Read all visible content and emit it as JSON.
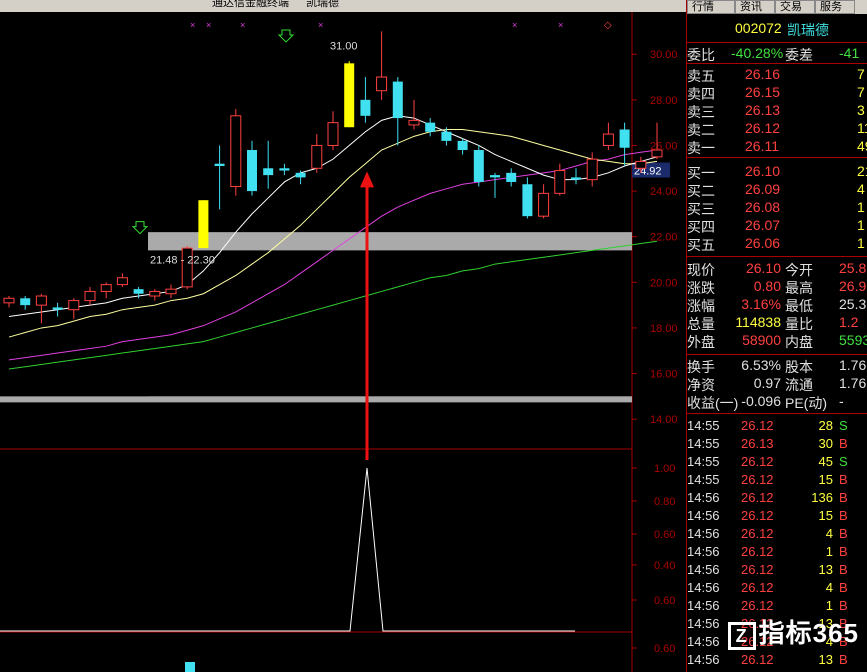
{
  "title": {
    "app": "通达信金融终端",
    "stock_name": "凯瑞德"
  },
  "tabs": [
    "行情",
    "资讯",
    "交易",
    "服务"
  ],
  "chart_data": {
    "type": "candlestick",
    "price_ticks": [
      "30.00",
      "28.00",
      "26.00",
      "24.00",
      "22.00",
      "20.00",
      "18.00",
      "16.00",
      "14.00"
    ],
    "price_range": [
      13.0,
      31.5
    ],
    "current_price_label": "24.92",
    "annotations": [
      "31.00",
      "21.48 - 22.30"
    ],
    "candles": [
      {
        "o": 19.1,
        "c": 19.3,
        "h": 19.4,
        "l": 18.9
      },
      {
        "o": 19.3,
        "c": 19.0,
        "h": 19.4,
        "l": 18.8
      },
      {
        "o": 19.0,
        "c": 19.4,
        "h": 19.5,
        "l": 18.2
      },
      {
        "o": 18.9,
        "c": 18.8,
        "h": 19.1,
        "l": 18.5
      },
      {
        "o": 18.8,
        "c": 19.2,
        "h": 19.3,
        "l": 18.4
      },
      {
        "o": 19.2,
        "c": 19.6,
        "h": 19.8,
        "l": 19.0
      },
      {
        "o": 19.6,
        "c": 19.9,
        "h": 20.0,
        "l": 19.3
      },
      {
        "o": 19.9,
        "c": 20.2,
        "h": 20.4,
        "l": 19.8
      },
      {
        "o": 19.7,
        "c": 19.5,
        "h": 19.8,
        "l": 19.3
      },
      {
        "o": 19.4,
        "c": 19.6,
        "h": 19.7,
        "l": 19.2
      },
      {
        "o": 19.5,
        "c": 19.7,
        "h": 19.9,
        "l": 19.3
      },
      {
        "o": 19.8,
        "c": 21.5,
        "h": 21.6,
        "l": 19.7
      },
      {
        "o": 21.5,
        "c": 23.6,
        "h": 23.6,
        "l": 21.5
      },
      {
        "o": 25.2,
        "c": 25.1,
        "h": 26.0,
        "l": 23.2
      },
      {
        "o": 24.2,
        "c": 27.3,
        "h": 27.6,
        "l": 23.8
      },
      {
        "o": 25.8,
        "c": 24.0,
        "h": 26.2,
        "l": 23.8
      },
      {
        "o": 25.0,
        "c": 24.7,
        "h": 26.2,
        "l": 24.1
      },
      {
        "o": 25.0,
        "c": 24.9,
        "h": 25.2,
        "l": 24.7
      },
      {
        "o": 24.8,
        "c": 24.6,
        "h": 24.9,
        "l": 24.3
      },
      {
        "o": 25.0,
        "c": 26.0,
        "h": 26.5,
        "l": 24.8
      },
      {
        "o": 26.0,
        "c": 27.0,
        "h": 27.5,
        "l": 25.8
      },
      {
        "o": 26.8,
        "c": 29.6,
        "h": 29.7,
        "l": 26.8
      },
      {
        "o": 28.0,
        "c": 27.3,
        "h": 29.0,
        "l": 27.0
      },
      {
        "o": 28.4,
        "c": 29.0,
        "h": 31.0,
        "l": 28.0
      },
      {
        "o": 28.8,
        "c": 27.2,
        "h": 29.0,
        "l": 26.0
      },
      {
        "o": 26.9,
        "c": 27.1,
        "h": 28.0,
        "l": 26.7
      },
      {
        "o": 27.0,
        "c": 26.6,
        "h": 27.2,
        "l": 26.4
      },
      {
        "o": 26.6,
        "c": 26.2,
        "h": 26.8,
        "l": 26.0
      },
      {
        "o": 26.2,
        "c": 25.8,
        "h": 26.3,
        "l": 25.6
      },
      {
        "o": 25.8,
        "c": 24.4,
        "h": 26.0,
        "l": 24.2
      },
      {
        "o": 24.7,
        "c": 24.6,
        "h": 24.8,
        "l": 23.7
      },
      {
        "o": 24.8,
        "c": 24.4,
        "h": 25.0,
        "l": 24.2
      },
      {
        "o": 24.3,
        "c": 22.9,
        "h": 24.6,
        "l": 22.8
      },
      {
        "o": 22.9,
        "c": 23.9,
        "h": 24.3,
        "l": 22.8
      },
      {
        "o": 23.9,
        "c": 24.9,
        "h": 25.2,
        "l": 23.8
      },
      {
        "o": 24.6,
        "c": 24.5,
        "h": 25.0,
        "l": 24.3
      },
      {
        "o": 24.5,
        "c": 25.4,
        "h": 25.7,
        "l": 24.2
      },
      {
        "o": 26.0,
        "c": 26.5,
        "h": 27.0,
        "l": 25.8
      },
      {
        "o": 26.7,
        "c": 25.9,
        "h": 27.0,
        "l": 25.1
      },
      {
        "o": 25.0,
        "c": 25.3,
        "h": 25.5,
        "l": 24.8
      },
      {
        "o": 25.5,
        "c": 25.8,
        "h": 27.0,
        "l": 25.4
      }
    ],
    "ma_white": [
      18.5,
      18.6,
      18.7,
      18.8,
      18.9,
      19.0,
      19.1,
      19.3,
      19.4,
      19.5,
      19.6,
      19.9,
      20.5,
      21.3,
      22.2,
      23.0,
      23.7,
      24.4,
      24.8,
      25.0,
      25.4,
      26.0,
      26.6,
      27.1,
      27.3,
      27.2,
      26.9,
      26.6,
      26.3,
      26.0,
      25.6,
      25.3,
      25.0,
      24.7,
      24.5,
      24.5,
      24.6,
      24.8,
      25.1,
      25.3,
      25.5
    ],
    "ma_yellow": [
      17.6,
      17.8,
      18.0,
      18.1,
      18.3,
      18.5,
      18.6,
      18.8,
      18.9,
      19.0,
      19.2,
      19.3,
      19.5,
      19.9,
      20.3,
      20.8,
      21.3,
      21.9,
      22.5,
      23.2,
      23.9,
      24.6,
      25.2,
      25.8,
      26.1,
      26.4,
      26.6,
      26.7,
      26.7,
      26.6,
      26.5,
      26.4,
      26.2,
      26.0,
      25.8,
      25.6,
      25.4,
      25.3,
      25.2,
      25.2,
      25.3
    ],
    "ma_magenta": [
      16.6,
      16.7,
      16.8,
      16.9,
      17.0,
      17.1,
      17.2,
      17.4,
      17.5,
      17.6,
      17.7,
      17.9,
      18.1,
      18.4,
      18.7,
      19.1,
      19.5,
      19.9,
      20.4,
      20.9,
      21.4,
      21.9,
      22.4,
      22.9,
      23.3,
      23.6,
      23.9,
      24.1,
      24.3,
      24.4,
      24.5,
      24.6,
      24.7,
      24.8,
      24.9,
      25.1,
      25.3,
      25.4,
      25.6,
      25.7,
      25.8
    ],
    "ma_green": [
      16.2,
      16.3,
      16.4,
      16.5,
      16.6,
      16.7,
      16.8,
      16.9,
      17.0,
      17.1,
      17.2,
      17.3,
      17.4,
      17.6,
      17.8,
      18.0,
      18.2,
      18.4,
      18.6,
      18.8,
      19.0,
      19.2,
      19.4,
      19.6,
      19.8,
      20.0,
      20.2,
      20.3,
      20.5,
      20.6,
      20.8,
      20.9,
      21.0,
      21.1,
      21.2,
      21.3,
      21.4,
      21.5,
      21.6,
      21.7,
      21.8
    ],
    "zones": [
      [
        21.4,
        22.2
      ],
      [
        14.8,
        15.0
      ]
    ],
    "indicator_ticks": [
      "1.00",
      "0.80",
      "0.60",
      "0.40",
      "0.60",
      "0.60"
    ],
    "indicator_peak_index": 22
  },
  "quote": {
    "code": "002072",
    "name": "凯瑞德",
    "weibi_label": "委比",
    "weibi_value": "-40.28%",
    "weicha_label": "委差",
    "weicha_value": "-41",
    "sell": [
      {
        "label": "卖五",
        "price": "26.16",
        "vol": "7"
      },
      {
        "label": "卖四",
        "price": "26.15",
        "vol": "7"
      },
      {
        "label": "卖三",
        "price": "26.13",
        "vol": "3"
      },
      {
        "label": "卖二",
        "price": "26.12",
        "vol": "11"
      },
      {
        "label": "卖一",
        "price": "26.11",
        "vol": "49"
      }
    ],
    "buy": [
      {
        "label": "买一",
        "price": "26.10",
        "vol": "21"
      },
      {
        "label": "买二",
        "price": "26.09",
        "vol": "4"
      },
      {
        "label": "买三",
        "price": "26.08",
        "vol": "1"
      },
      {
        "label": "买四",
        "price": "26.07",
        "vol": "1"
      },
      {
        "label": "买五",
        "price": "26.06",
        "vol": "1"
      }
    ],
    "stats": [
      {
        "l1": "现价",
        "v1": "26.10",
        "c1": "r",
        "l2": "今开",
        "v2": "25.8",
        "c2": "r"
      },
      {
        "l1": "涨跌",
        "v1": "0.80",
        "c1": "r",
        "l2": "最高",
        "v2": "26.9",
        "c2": "r"
      },
      {
        "l1": "涨幅",
        "v1": "3.16%",
        "c1": "r",
        "l2": "最低",
        "v2": "25.3",
        "c2": "w"
      },
      {
        "l1": "总量",
        "v1": "114838",
        "c1": "y",
        "l2": "量比",
        "v2": "1.2",
        "c2": "r"
      },
      {
        "l1": "外盘",
        "v1": "58900",
        "c1": "r",
        "l2": "内盘",
        "v2": "5593",
        "c2": "g"
      }
    ],
    "stats2": [
      {
        "l1": "换手",
        "v1": "6.53%",
        "c1": "w",
        "l2": "股本",
        "v2": "1.76",
        "c2": "w"
      },
      {
        "l1": "净资",
        "v1": "0.97",
        "c1": "w",
        "l2": "流通",
        "v2": "1.76",
        "c2": "w"
      },
      {
        "l1": "收益(一)",
        "v1": "-0.096",
        "c1": "w",
        "l2": "PE(动)",
        "v2": "-",
        "c2": "w"
      }
    ]
  },
  "ticks": [
    {
      "t": "14:55",
      "p": "26.12",
      "v": "28",
      "s": "S"
    },
    {
      "t": "14:55",
      "p": "26.13",
      "v": "30",
      "s": "B"
    },
    {
      "t": "14:55",
      "p": "26.12",
      "v": "45",
      "s": "S"
    },
    {
      "t": "14:55",
      "p": "26.12",
      "v": "15",
      "s": "B"
    },
    {
      "t": "14:56",
      "p": "26.12",
      "v": "136",
      "s": "B"
    },
    {
      "t": "14:56",
      "p": "26.12",
      "v": "15",
      "s": "B"
    },
    {
      "t": "14:56",
      "p": "26.12",
      "v": "4",
      "s": "B"
    },
    {
      "t": "14:56",
      "p": "26.12",
      "v": "1",
      "s": "B"
    },
    {
      "t": "14:56",
      "p": "26.12",
      "v": "13",
      "s": "B"
    },
    {
      "t": "14:56",
      "p": "26.12",
      "v": "4",
      "s": "B"
    },
    {
      "t": "14:56",
      "p": "26.12",
      "v": "1",
      "s": "B"
    },
    {
      "t": "14:56",
      "p": "26.12",
      "v": "13",
      "s": "B"
    },
    {
      "t": "14:56",
      "p": "26.12",
      "v": "4",
      "s": "B"
    },
    {
      "t": "14:56",
      "p": "26.12",
      "v": "13",
      "s": "B"
    }
  ],
  "watermark": "指标365",
  "colors": {
    "up": "#ff4040",
    "down": "#40e0f0",
    "limit": "#ffff00",
    "axis": "#aa0000"
  }
}
